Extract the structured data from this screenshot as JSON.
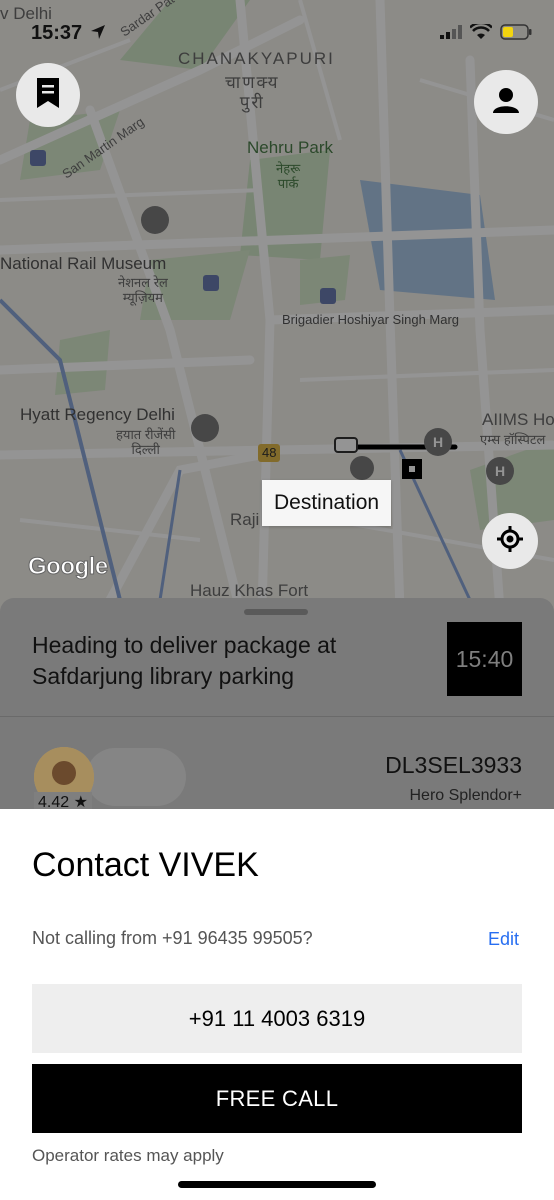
{
  "status_bar": {
    "time": "15:37"
  },
  "map": {
    "labels": {
      "delhi_corner": "v Delhi",
      "sardar_patel": "Sardar Patel",
      "chanakyapuri_en": "CHANAKYAPURI",
      "chanakyapuri_hi": "चाणक्य\nपुरी",
      "nehru_park_en": "Nehru Park",
      "nehru_park_hi": "नेहरू\nपार्क",
      "san_martin": "San Martin Marg",
      "rail_museum_en": "National Rail Museum",
      "rail_museum_hi": "नेशनल रेल\nम्यूज़ियम",
      "brigadier": "Brigadier Hoshiyar Singh Marg",
      "hyatt_en": "Hyatt Regency Delhi",
      "hyatt_hi": "हयात रीजेंसी\nदिल्ली",
      "aiims_en": "AIIMS Ho",
      "aiims_hi": "एम्स हॉस्पिटल",
      "highway_48": "48",
      "rajiv": "Raji",
      "hauz_khas": "Hauz Khas Fort"
    },
    "destination_label": "Destination",
    "google_logo": "Google"
  },
  "trip": {
    "heading": "Heading to deliver package at Safdarjung library parking",
    "eta": "15:40",
    "driver_rating": "4.42 ★",
    "plate": "DL3SEL3933",
    "vehicle": "Hero Splendor+"
  },
  "contact_sheet": {
    "title": "Contact VIVEK",
    "not_calling_text": "Not calling from +91 96435 99505?",
    "edit_label": "Edit",
    "phone_number": "+91 11 4003 6319",
    "free_call_label": "FREE CALL",
    "operator_note": "Operator rates may apply"
  },
  "colors": {
    "accent_link": "#276ef1",
    "primary_button": "#000000",
    "secondary_button": "#eeeeee"
  }
}
